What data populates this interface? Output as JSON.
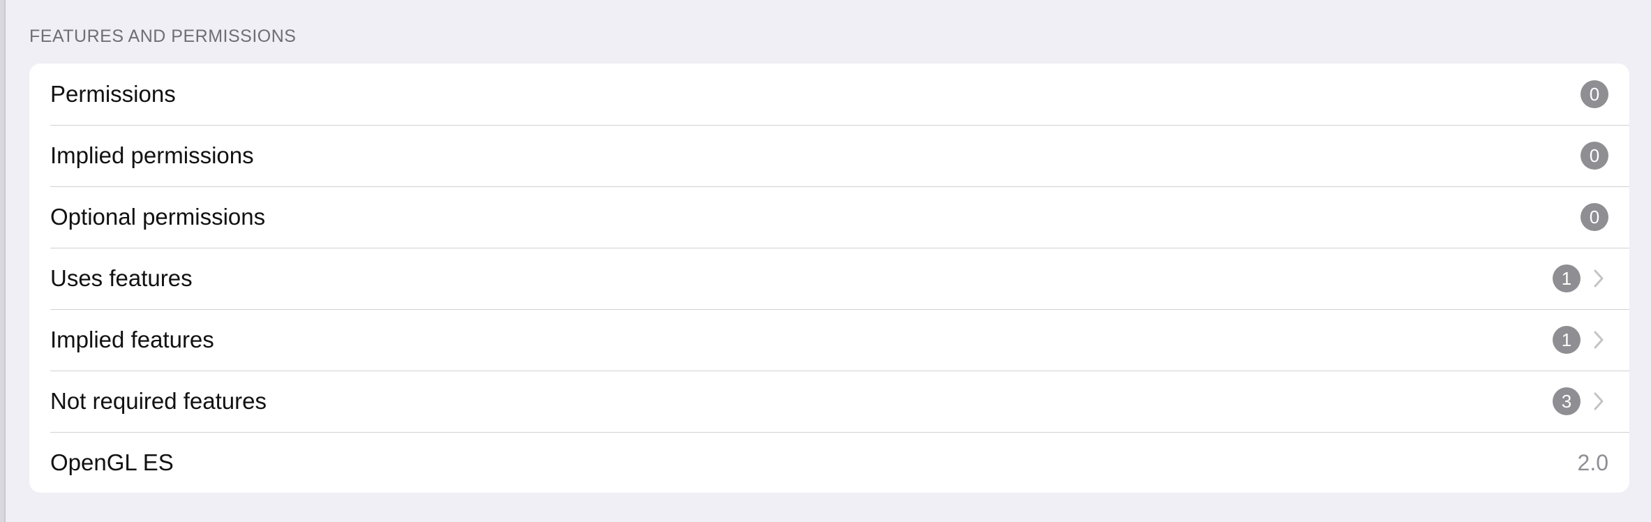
{
  "section": {
    "title": "FEATURES AND PERMISSIONS"
  },
  "rows": [
    {
      "label": "Permissions",
      "badge": "0"
    },
    {
      "label": "Implied permissions",
      "badge": "0"
    },
    {
      "label": "Optional permissions",
      "badge": "0"
    },
    {
      "label": "Uses features",
      "badge": "1",
      "icon": "chevron-right-icon"
    },
    {
      "label": "Implied features",
      "badge": "1",
      "icon": "chevron-right-icon"
    },
    {
      "label": "Not required features",
      "badge": "3",
      "icon": "chevron-right-icon"
    },
    {
      "label": "OpenGL ES",
      "value": "2.0"
    }
  ],
  "colors": {
    "background": "#f0eff5",
    "card": "#ffffff",
    "badge": "#8e8e93",
    "secondary_text": "#8e8e93",
    "separator": "#d1d1d6"
  }
}
